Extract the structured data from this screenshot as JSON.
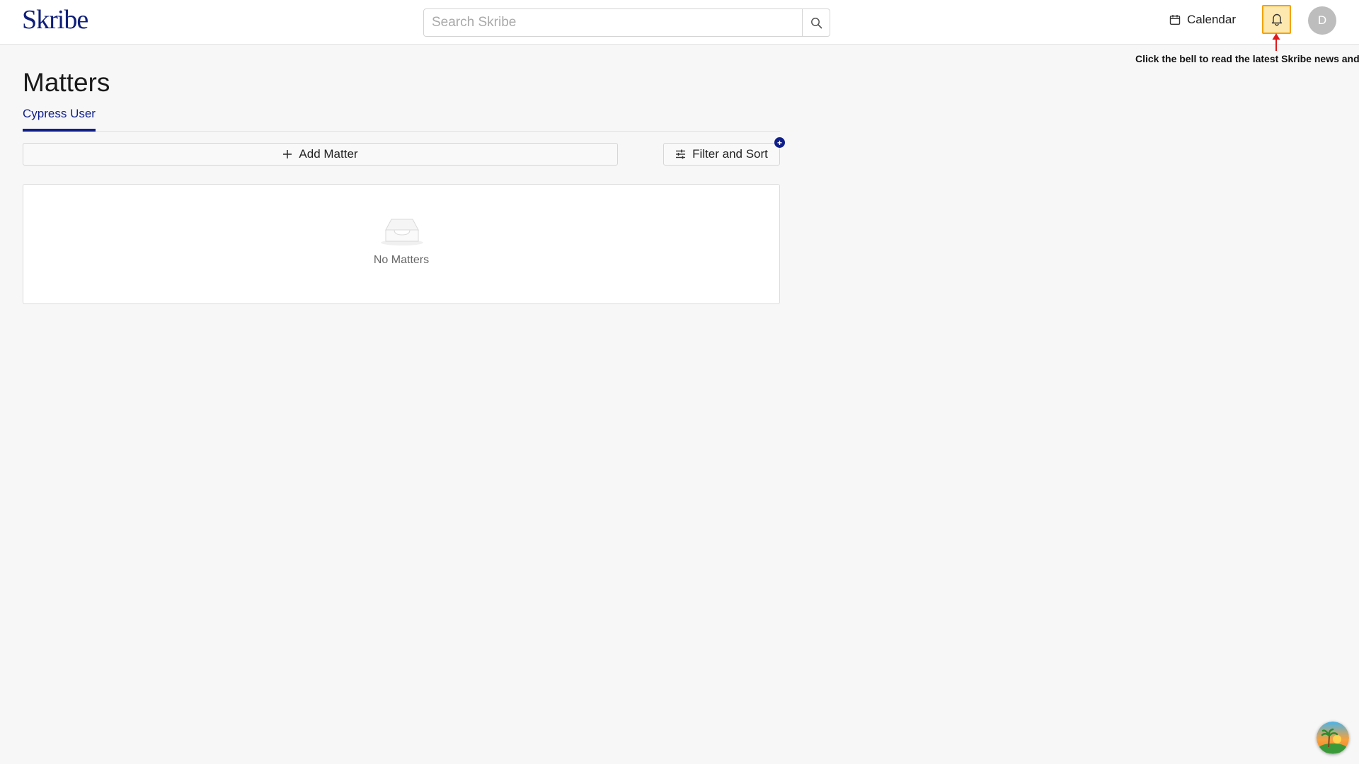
{
  "header": {
    "logo_text": "Skribe",
    "search": {
      "placeholder": "Search Skribe",
      "value": ""
    },
    "calendar_label": "Calendar",
    "avatar_initial": "D",
    "hint_text": "Click the bell to read the latest Skribe news and pro"
  },
  "page": {
    "title": "Matters",
    "tabs": [
      {
        "label": "Cypress User",
        "active": true
      }
    ]
  },
  "toolbar": {
    "add_matter_label": "Add Matter",
    "filter_sort_label": "Filter and Sort",
    "filter_badge": "+"
  },
  "matters": {
    "items": [],
    "empty_text": "No Matters"
  },
  "colors": {
    "brand": "#0f1f7a",
    "accent": "#0f1f8a",
    "bell_highlight": "#fde8b0",
    "bell_border": "#f2a300",
    "hint_arrow": "#e01b1b"
  },
  "icons": [
    "search-icon",
    "calendar-icon",
    "bell-icon",
    "plus-icon",
    "sliders-icon",
    "inbox-icon"
  ]
}
